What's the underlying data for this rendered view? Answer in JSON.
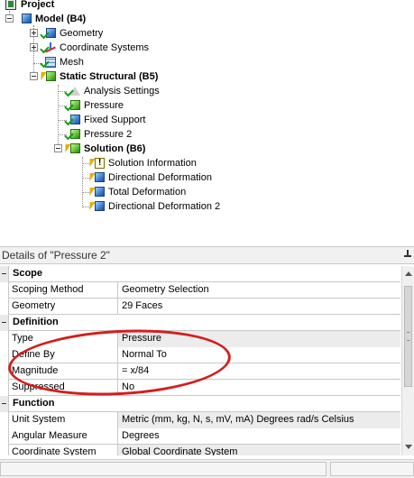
{
  "tree": {
    "project": "Project",
    "model": "Model (B4)",
    "geometry": "Geometry",
    "coordinate_systems": "Coordinate Systems",
    "mesh": "Mesh",
    "static_structural": "Static Structural (B5)",
    "analysis_settings": "Analysis Settings",
    "pressure": "Pressure",
    "fixed_support": "Fixed Support",
    "pressure2": "Pressure 2",
    "solution": "Solution (B6)",
    "solution_information": "Solution Information",
    "directional_deformation": "Directional Deformation",
    "total_deformation": "Total Deformation",
    "directional_deformation2": "Directional Deformation 2"
  },
  "details": {
    "title": "Details of \"Pressure 2\"",
    "scope": {
      "header": "Scope",
      "scoping_method_label": "Scoping Method",
      "scoping_method_value": "Geometry Selection",
      "geometry_label": "Geometry",
      "geometry_value": "29 Faces"
    },
    "definition": {
      "header": "Definition",
      "type_label": "Type",
      "type_value": "Pressure",
      "define_by_label": "Define By",
      "define_by_value": "Normal To",
      "magnitude_label": "Magnitude",
      "magnitude_value": "= x/84",
      "suppressed_label": "Suppressed",
      "suppressed_value": "No"
    },
    "function": {
      "header": "Function",
      "unit_system_label": "Unit System",
      "unit_system_value": "Metric (mm, kg, N, s, mV, mA)  Degrees  rad/s  Celsius",
      "angular_measure_label": "Angular Measure",
      "angular_measure_value": "Degrees",
      "coordinate_system_label": "Coordinate System",
      "coordinate_system_value": "Global Coordinate System"
    }
  },
  "colors": {
    "annotation": "#d41e1e",
    "check": "#10a010",
    "bolt": "#e0b000"
  }
}
